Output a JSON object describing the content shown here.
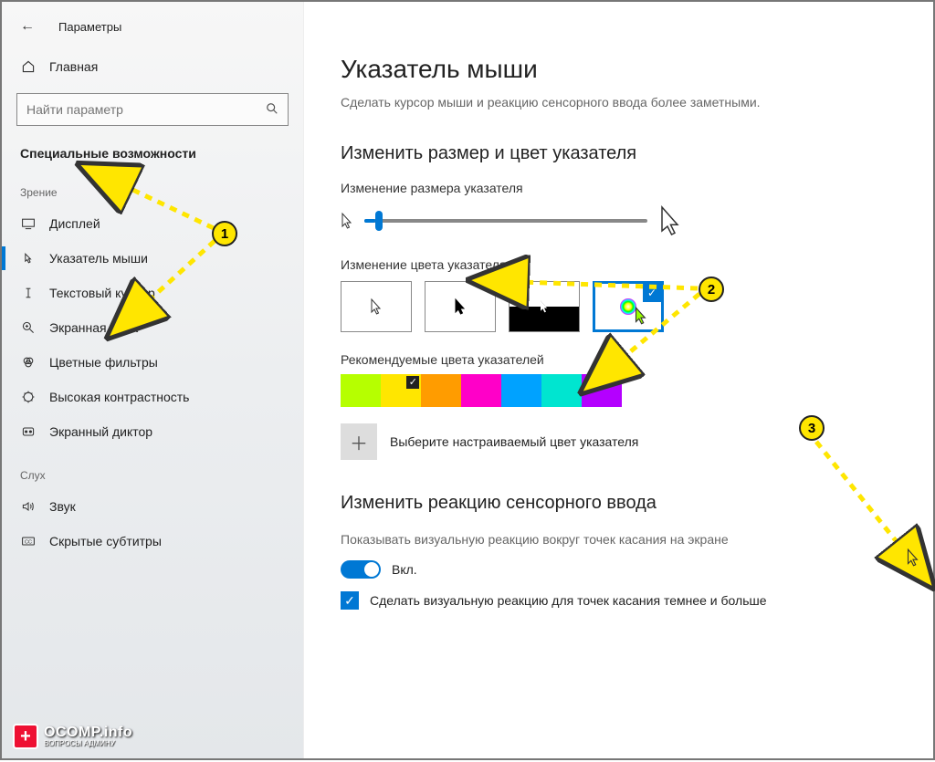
{
  "header": {
    "title": "Параметры"
  },
  "home": {
    "label": "Главная"
  },
  "search": {
    "placeholder": "Найти параметр"
  },
  "section": "Специальные возможности",
  "groups": [
    {
      "label": "Зрение",
      "items": [
        {
          "icon": "display",
          "label": "Дисплей"
        },
        {
          "icon": "pointer",
          "label": "Указатель мыши",
          "active": true
        },
        {
          "icon": "textcursor",
          "label": "Текстовый курсор"
        },
        {
          "icon": "magnifier",
          "label": "Экранная лупа"
        },
        {
          "icon": "colorfilter",
          "label": "Цветные фильтры"
        },
        {
          "icon": "contrast",
          "label": "Высокая контрастность"
        },
        {
          "icon": "narrator",
          "label": "Экранный диктор"
        }
      ]
    },
    {
      "label": "Слух",
      "items": [
        {
          "icon": "sound",
          "label": "Звук"
        },
        {
          "icon": "cc",
          "label": "Скрытые субтитры"
        }
      ]
    }
  ],
  "page": {
    "title": "Указатель мыши",
    "desc": "Сделать курсор мыши и реакцию сенсорного ввода более заметными.",
    "size_section": "Изменить размер и цвет указателя",
    "size_label": "Изменение размера указателя",
    "color_label": "Изменение цвета указателя",
    "rec_label": "Рекомендуемые цвета указателей",
    "custom_label": "Выберите настраиваемый цвет указателя",
    "touch_section": "Изменить реакцию сенсорного ввода",
    "touch_desc": "Показывать визуальную реакцию вокруг точек касания на экране",
    "toggle_on": "Вкл.",
    "check_label": "Сделать визуальную реакцию для точек касания темнее и больше"
  },
  "swatch_colors": [
    "#b6ff00",
    "#ffe600",
    "#ff9c00",
    "#ff00c8",
    "#00a2ff",
    "#00e5d0",
    "#b400ff"
  ],
  "selected_swatch": 1,
  "annotations": {
    "1": "1",
    "2": "2",
    "3": "3"
  },
  "logo": {
    "brand": "OCOMP.info",
    "sub": "ВОПРОСЫ АДМИНУ"
  }
}
